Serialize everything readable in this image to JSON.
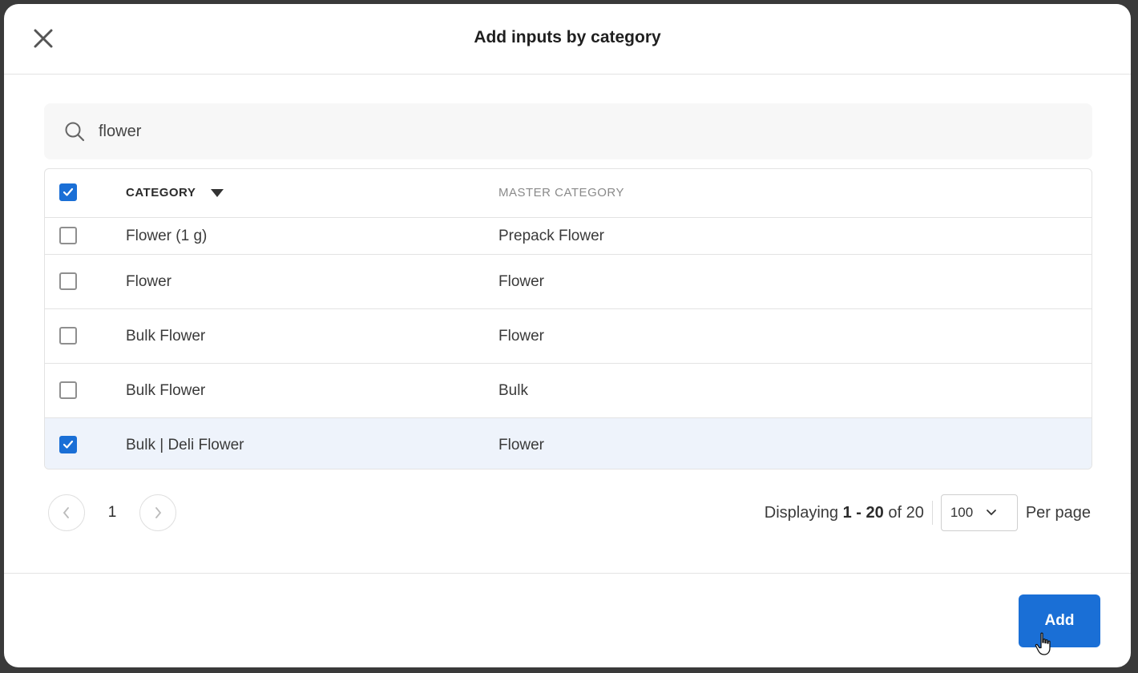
{
  "modal": {
    "title": "Add inputs by category"
  },
  "search": {
    "value": "flower",
    "placeholder": "Search"
  },
  "table": {
    "columns": {
      "category": "CATEGORY",
      "master_category": "MASTER CATEGORY"
    },
    "header_checkbox_checked": true,
    "rows": [
      {
        "category": "Flower (1 g)",
        "master_category": "Prepack Flower",
        "checked": false
      },
      {
        "category": "Flower",
        "master_category": "Flower",
        "checked": false
      },
      {
        "category": "Bulk Flower",
        "master_category": "Flower",
        "checked": false
      },
      {
        "category": "Bulk Flower",
        "master_category": "Bulk",
        "checked": false
      },
      {
        "category": "Bulk | Deli Flower",
        "master_category": "Flower",
        "checked": true
      }
    ]
  },
  "pagination": {
    "current_page": "1",
    "displaying_prefix": "Displaying",
    "range": "1 - 20",
    "of_label": "of",
    "total": "20",
    "per_page_value": "100",
    "per_page_label": "Per page"
  },
  "footer": {
    "add_label": "Add"
  },
  "colors": {
    "accent": "#1a6fd6",
    "selected_row": "#eef3fb"
  }
}
